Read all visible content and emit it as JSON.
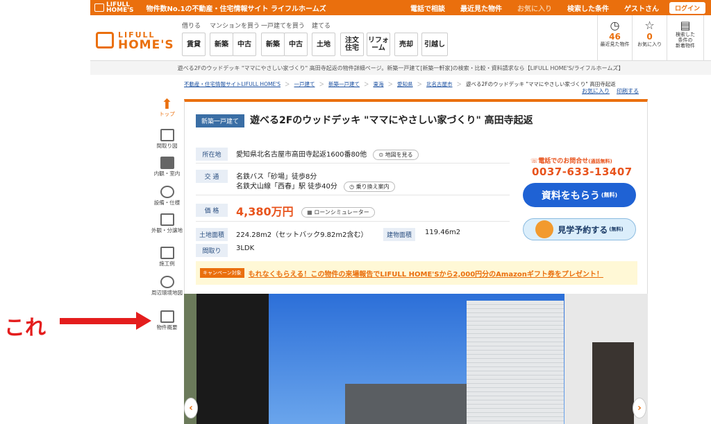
{
  "topbar": {
    "logo_line1": "LIFULL",
    "logo_line2": "HOME'S",
    "tagline": "物件数No.1の不動産・住宅情報サイト ライフルホームズ",
    "links": [
      "電話で相談",
      "最近見た物件",
      "お気に入り",
      "検索した条件",
      "ゲストさん"
    ],
    "login": "ログイン"
  },
  "header": {
    "brand_line1": "LIFULL",
    "brand_line2": "HOME'S",
    "groups": [
      "借りる",
      "マンションを買う",
      "一戸建てを買う",
      "建てる"
    ],
    "buttons": [
      "賃貸",
      "新築",
      "中古",
      "新築",
      "中古",
      "土地",
      "注文\n住宅",
      "リフォ\nーム",
      "売却",
      "引越し"
    ],
    "icons": [
      {
        "name": "recent",
        "count": "46",
        "label": "最近見た物件"
      },
      {
        "name": "favorites",
        "count": "0",
        "label": "お気に入り"
      },
      {
        "name": "saved-search",
        "label": "検索した\n条件の\n新着物件"
      }
    ]
  },
  "strip_text": "遊べる2Fのウッドデッキ \"ママにやさしい家づくり\" 高田寺起返の物件詳細ページ。新築一戸建て[新築一軒家]の検索・比較・資料請求なら【LIFULL HOME'S/ライフルホームズ】",
  "breadcrumb": [
    "不動産・住宅情報サイトLIFULL HOME'S",
    "一戸建て",
    "新築一戸建て",
    "東海",
    "愛知県",
    "北名古屋市",
    "遊べる2Fのウッドデッキ \"ママにやさしい家づくり\" 高田寺起返"
  ],
  "fav_link": "お気に入り",
  "print_link": "印刷する",
  "leftnav": [
    "トップ",
    "間取り図",
    "内観・室内",
    "設備・仕様",
    "外観・分譲地",
    "施工例",
    "周辺環境地図",
    "物件概要"
  ],
  "annotation": "これ",
  "listing": {
    "badge": "新築一戸建て",
    "title": "遊べる2Fのウッドデッキ \"ママにやさしい家づくり\" 高田寺起返",
    "address_label": "所在地",
    "address": "愛知県北名古屋市高田寺起返1600番80他",
    "map_pill": "地図を見る",
    "transport_label": "交 通",
    "transport1": "名鉄バス「砂場」徒歩8分",
    "transport2": "名鉄犬山線「西春」駅 徒歩40分",
    "transfer_pill": "乗り換え案内",
    "price_label": "価 格",
    "price": "4,380万円",
    "loan_pill": "ローンシミュレーター",
    "land_label": "土地面積",
    "land": "224.28m2（セットバック9.82m2含む）",
    "building_label": "建物面積",
    "building": "119.46m2",
    "layout_label": "間取り",
    "layout": "3LDK",
    "phone_label": "電話でのお問合せ",
    "phone_note": "(通話無料)",
    "phone": "0037-633-13407",
    "doc_button": "資料をもらう",
    "doc_note": "(無料)",
    "visit_button": "見学予約する",
    "visit_note": "(無料)",
    "campaign_tag": "キャンペーン対象",
    "campaign_text": "もれなくもらえる！この物件の来場報告でLIFULL HOME'Sから2,000円分のAmazonギフト券をプレゼント！"
  },
  "gallery": {
    "prev": "‹",
    "next": "›"
  },
  "colors": {
    "accent": "#ea6f0d",
    "primary_button": "#1f62d4",
    "price": "#e8531c",
    "annotation": "#e41d1d"
  }
}
